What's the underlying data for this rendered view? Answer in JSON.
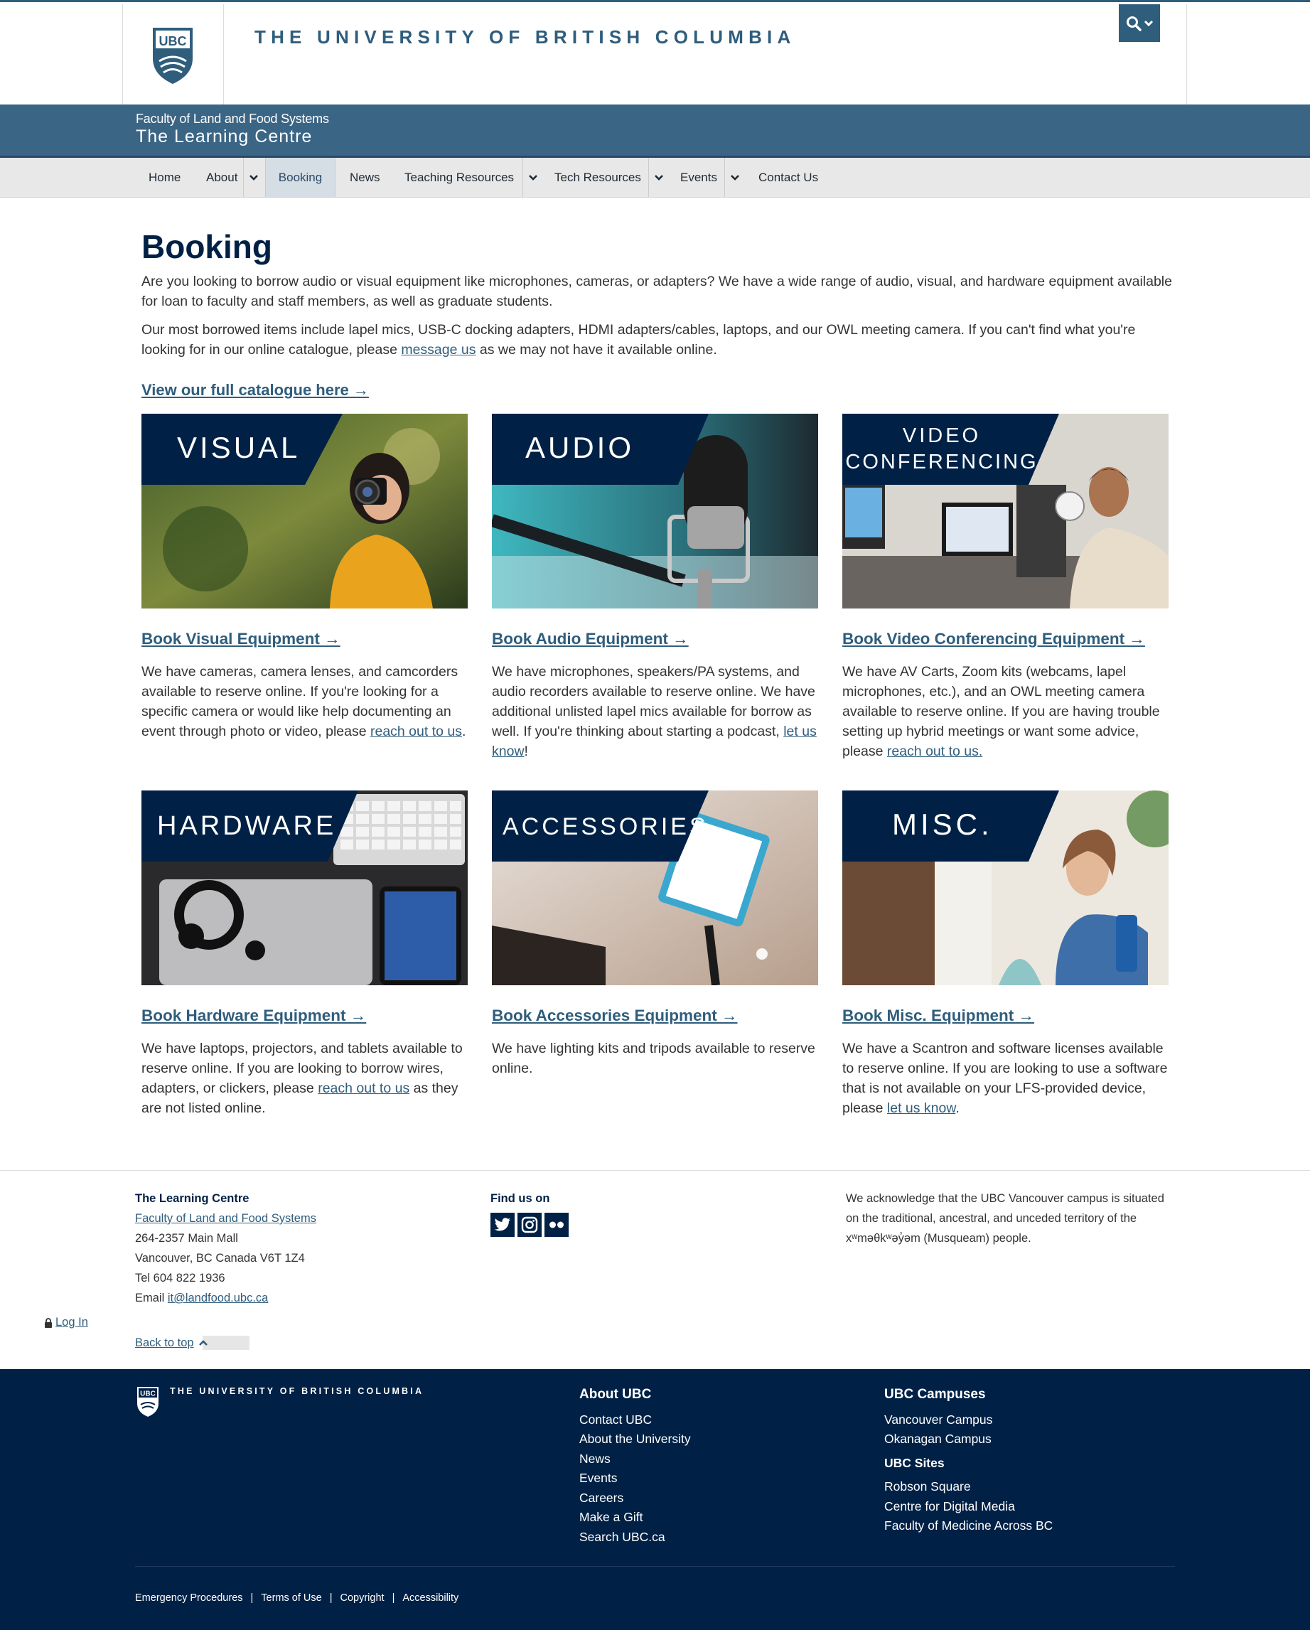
{
  "ubc_header": {
    "crest_text": "UBC",
    "wordmark": "THE UNIVERSITY OF BRITISH COLUMBIA"
  },
  "unit": {
    "faculty": "Faculty of Land and Food Systems",
    "name": "The Learning Centre"
  },
  "nav": {
    "items": [
      {
        "label": "Home"
      },
      {
        "label": "About"
      },
      {
        "label": "Booking"
      },
      {
        "label": "News"
      },
      {
        "label": "Teaching Resources"
      },
      {
        "label": "Tech Resources"
      },
      {
        "label": "Events"
      },
      {
        "label": "Contact Us"
      }
    ],
    "active": "Booking"
  },
  "main": {
    "title": "Booking",
    "intro_1": "Are you looking to borrow audio or visual equipment like microphones, cameras, or adapters? We have a wide range of audio, visual, and hardware equipment available for loan to faculty and staff members, as well as graduate students.",
    "intro_2_before": "Our most borrowed items include lapel mics, USB-C docking adapters, HDMI adapters/cables, laptops, and our OWL meeting camera. If you can't find what you're looking for in our online catalogue, please ",
    "intro_2_link": "message us",
    "intro_2_after": " as we may not have it available online.",
    "catalogue_link": "View our full catalogue here →"
  },
  "cards": [
    {
      "image_label": "VISUAL",
      "link": "Book Visual Equipment →",
      "text_before": "We have cameras, camera lenses, and camcorders available to reserve online. If you're looking for a specific camera or would like help documenting an event through photo or video, please ",
      "text_link": "reach out to us",
      "text_after": "."
    },
    {
      "image_label": "AUDIO",
      "link": "Book Audio Equipment →",
      "text_before": "We have microphones, speakers/PA systems, and audio recorders available to reserve online. We have additional unlisted lapel mics available for borrow as well. If you're thinking about starting a podcast, ",
      "text_link": "let us know",
      "text_after": "!"
    },
    {
      "image_label_1": "VIDEO",
      "image_label_2": "CONFERENCING",
      "link": "Book Video Conferencing Equipment →",
      "text_before": "We have AV Carts, Zoom kits (webcams, lapel microphones, etc.), and an OWL meeting camera available to reserve online. If you are having trouble setting up hybrid meetings or want some advice, please ",
      "text_link": "reach out to us.",
      "text_after": ""
    },
    {
      "image_label": "HARDWARE",
      "link": "Book Hardware Equipment →",
      "text_before": "We have laptops, projectors, and tablets available to reserve online. If you are looking to borrow wires, adapters, or clickers, please ",
      "text_link": "reach out to us",
      "text_after": " as they are not listed online."
    },
    {
      "image_label": "ACCESSORIES",
      "link": "Book Accessories Equipment →",
      "text_before": "We have lighting kits and tripods available to reserve online.",
      "text_link": "",
      "text_after": ""
    },
    {
      "image_label": "MISC.",
      "link": "Book Misc. Equipment →",
      "text_before": "We have a Scantron and software licenses available to reserve online. If you are looking to use a software that is not available on your LFS-provided device, please ",
      "text_link": "let us know",
      "text_after": "."
    }
  ],
  "unit_footer": {
    "org_name": "The Learning Centre",
    "faculty_link": "Faculty of Land and Food Systems",
    "address_1": "264-2357 Main Mall",
    "address_2": "Vancouver, BC Canada V6T 1Z4",
    "tel": "Tel 604 822 1936",
    "email_label": "Email ",
    "email": "it@landfood.ubc.ca",
    "find_us": "Find us on",
    "social_icons": [
      "twitter-icon",
      "instagram-icon",
      "flickr-icon"
    ],
    "acknowledgement": "We acknowledge that the UBC Vancouver campus is situated on the traditional, ancestral, and unceded territory of the xʷməθkʷəy̓əm (Musqueam) people.",
    "login": "Log In",
    "back_to_top": "Back to top"
  },
  "ubc_footer": {
    "crest_text": "UBC",
    "wordmark": "THE UNIVERSITY OF BRITISH COLUMBIA",
    "about_heading": "About UBC",
    "about_links": [
      "Contact UBC",
      "About the University",
      "News",
      "Events",
      "Careers",
      "Make a Gift",
      "Search UBC.ca"
    ],
    "campuses_heading": "UBC Campuses",
    "campus_links": [
      "Vancouver Campus",
      "Okanagan Campus"
    ],
    "sites_heading": "UBC Sites",
    "site_links": [
      "Robson Square",
      "Centre for Digital Media",
      "Faculty of Medicine Across BC"
    ],
    "legal_links": [
      "Emergency Procedures",
      "Terms of Use",
      "Copyright",
      "Accessibility"
    ]
  },
  "colors": {
    "ubc_navy": "#002145",
    "unit_blue": "#3b6584",
    "link_blue": "#2f5d7c",
    "nav_grey": "#e8e8e8"
  }
}
